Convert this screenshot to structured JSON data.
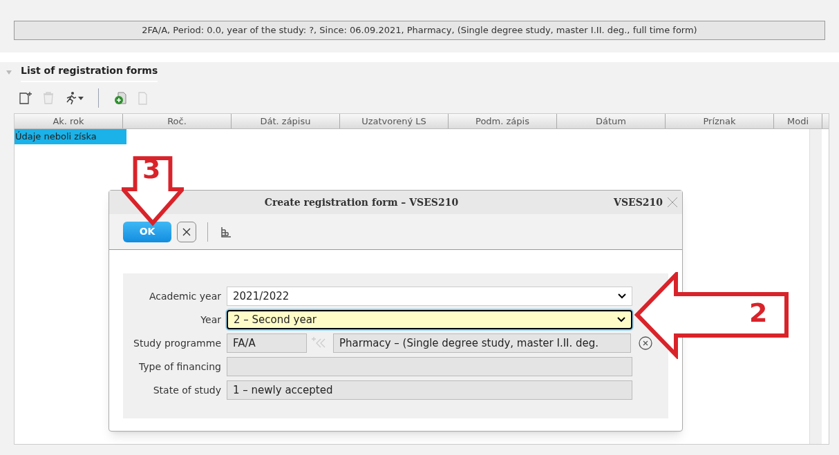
{
  "info_bar": "2FA/A, Period: 0.0, year of the study: ?, Since: 06.09.2021, Pharmacy, (Single degree study, master I.II. deg., full time form)",
  "section": {
    "title": "List of registration forms",
    "expanded": true
  },
  "toolbar": [
    {
      "kind": "new",
      "disabled": false
    },
    {
      "kind": "delete",
      "disabled": true
    },
    {
      "kind": "run",
      "disabled": false
    },
    {
      "kind": "sep"
    },
    {
      "kind": "add",
      "disabled": false
    },
    {
      "kind": "copy",
      "disabled": true
    }
  ],
  "table": {
    "columns": [
      "Ak. rok",
      "Roč.",
      "Dát. zápisu",
      "Uzatvorený LS",
      "Podm. zápis",
      "Dátum",
      "Príznak",
      "Modi"
    ],
    "rows": [
      {
        "text": "Údaje neboli získa",
        "selected": true
      }
    ]
  },
  "dialog": {
    "title": "Create registration form – VSES210",
    "code": "VSES210",
    "ok": "OK",
    "fields": [
      {
        "label": "Academic year",
        "kind": "select",
        "value": "2021/2022",
        "focused": false
      },
      {
        "label": "Year",
        "kind": "select",
        "value": "2 – Second year",
        "focused": true
      },
      {
        "label": "Study programme",
        "kind": "lookup",
        "code": "FA/A",
        "value": "Pharmacy – (Single degree study, master I.II. deg."
      },
      {
        "label": "Type of financing",
        "kind": "readonly"
      },
      {
        "label": "State of study",
        "kind": "readonly",
        "value": "1 – newly accepted"
      }
    ]
  },
  "annotations": [
    {
      "number": "3",
      "kind": "down"
    },
    {
      "number": "2",
      "kind": "left"
    }
  ]
}
